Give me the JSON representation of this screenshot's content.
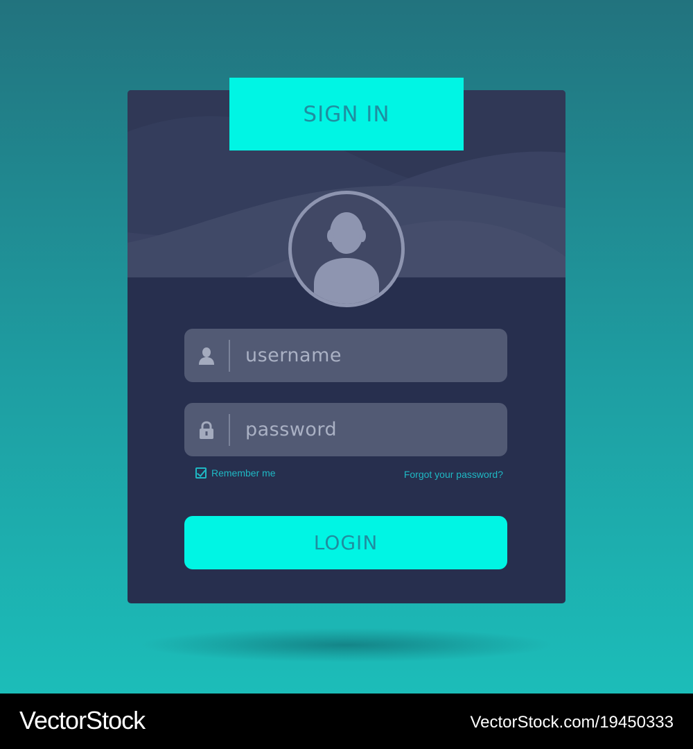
{
  "banner": {
    "title": "SIGN IN"
  },
  "form": {
    "username_placeholder": "username",
    "password_placeholder": "password",
    "remember_label": "Remember me",
    "remember_checked": true,
    "forgot_link": "Forgot your password?",
    "login_label": "LOGIN"
  },
  "icons": {
    "avatar": "user-avatar-icon",
    "username": "user-icon",
    "password": "lock-icon",
    "remember": "checkbox-icon"
  },
  "footer": {
    "brand": "VectorStock",
    "stock_id": "VectorStock.com/19450333"
  },
  "colors": {
    "background_top": "#22737e",
    "background_bottom": "#1cbdb9",
    "card": "#272f4e",
    "accent": "#00f5e4",
    "accent_text": "#1f8ea0",
    "field": "#525a74",
    "link": "#1fb8c4"
  }
}
